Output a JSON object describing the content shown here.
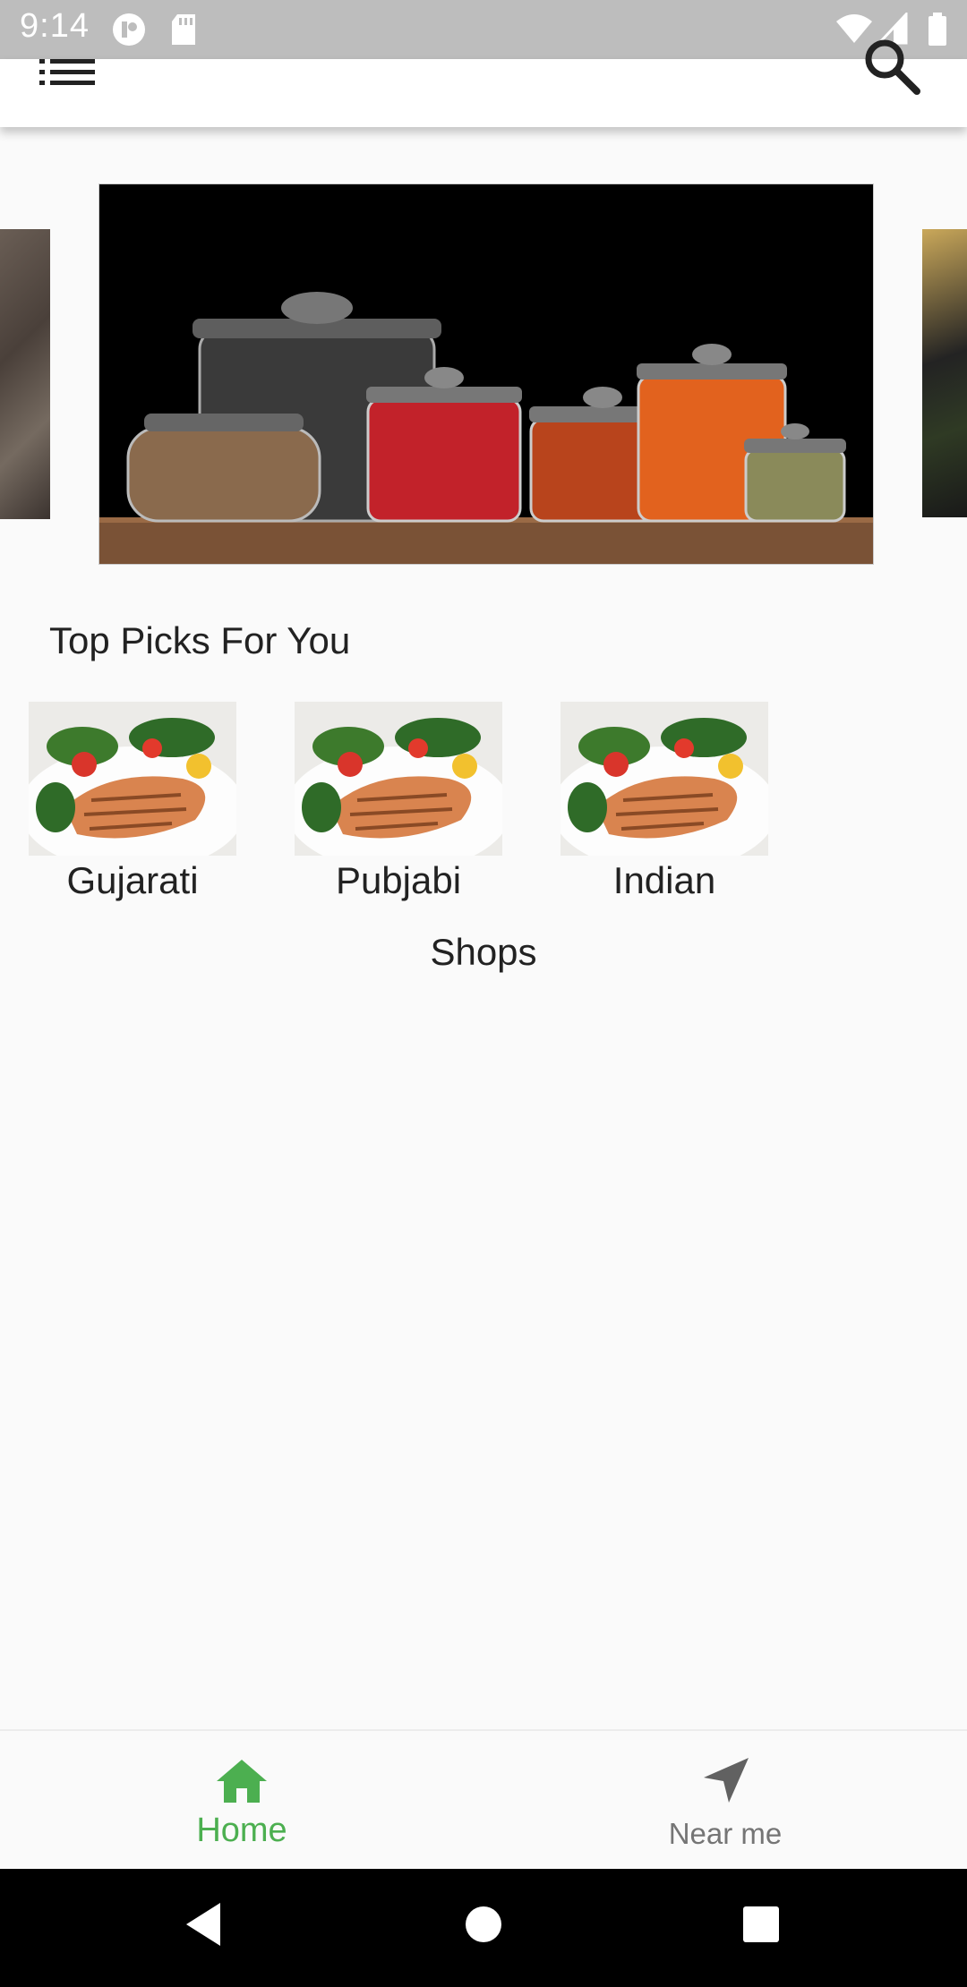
{
  "status_bar": {
    "time": "9:14",
    "icons": [
      "notification-icon",
      "sd-card-icon",
      "wifi-icon",
      "signal-icon",
      "battery-icon"
    ]
  },
  "app_bar": {
    "menu_icon": "list-icon",
    "search_icon": "search-icon"
  },
  "carousel": {
    "slides": [
      "spice-jars-photo",
      "stone-texture-photo",
      "sushi-plate-photo"
    ]
  },
  "top_picks": {
    "title": "Top Picks For You",
    "items": [
      {
        "label": "Gujarati",
        "image": "grilled-salmon-photo"
      },
      {
        "label": "Pubjabi",
        "image": "grilled-salmon-photo"
      },
      {
        "label": "Indian",
        "image": "grilled-salmon-photo"
      }
    ]
  },
  "shops": {
    "title": "Shops"
  },
  "bottom_nav": {
    "items": [
      {
        "label": "Home",
        "icon": "home-icon",
        "active": true
      },
      {
        "label": "Near me",
        "icon": "navigation-arrow-icon",
        "active": false
      }
    ],
    "active_color": "#4caf50",
    "inactive_color": "#757575"
  },
  "system_nav": {
    "buttons": [
      "back-icon",
      "home-circle-icon",
      "recents-icon"
    ]
  }
}
